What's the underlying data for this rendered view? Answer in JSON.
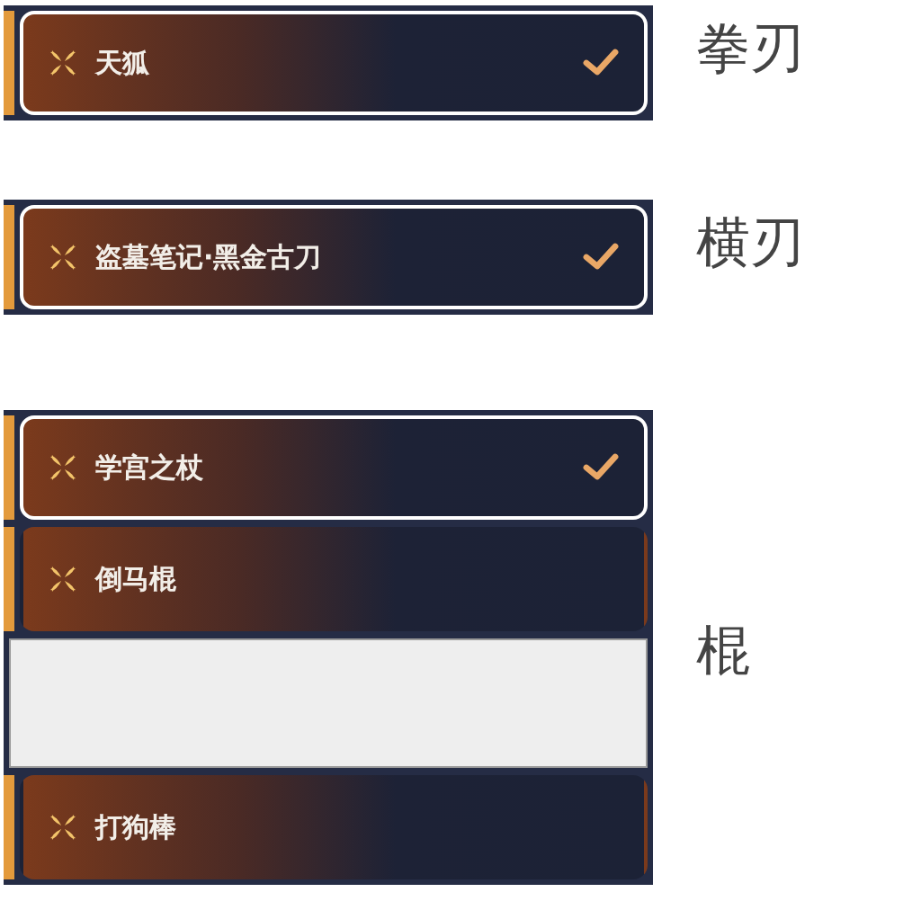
{
  "groups": [
    {
      "label": "拳刃",
      "items": [
        {
          "kind": "item",
          "name": "天狐",
          "checked": true
        }
      ]
    },
    {
      "label": "横刃",
      "items": [
        {
          "kind": "item",
          "name": "盗墓笔记·黑金古刀",
          "checked": true
        }
      ]
    },
    {
      "label": "棍",
      "items": [
        {
          "kind": "item",
          "name": "学宫之杖",
          "checked": true
        },
        {
          "kind": "item",
          "name": "倒马棍",
          "checked": false
        },
        {
          "kind": "blank"
        },
        {
          "kind": "item",
          "name": "打狗棒",
          "checked": false
        }
      ]
    }
  ]
}
